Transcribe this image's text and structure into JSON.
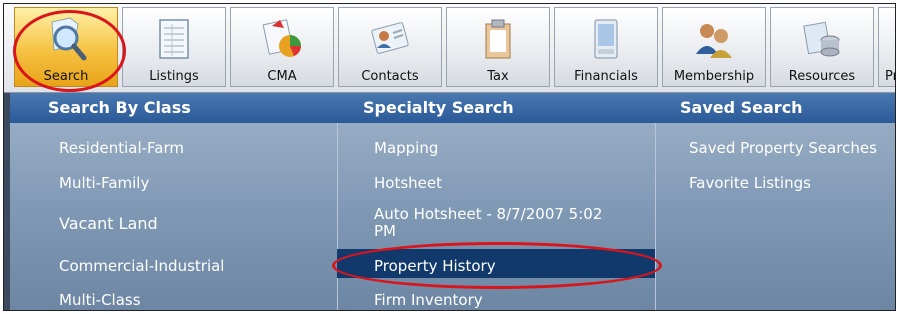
{
  "toolbar": {
    "buttons": [
      {
        "label": "Search",
        "icon": "search-icon"
      },
      {
        "label": "Listings",
        "icon": "listings-icon"
      },
      {
        "label": "CMA",
        "icon": "cma-icon"
      },
      {
        "label": "Contacts",
        "icon": "contacts-icon"
      },
      {
        "label": "Tax",
        "icon": "tax-icon"
      },
      {
        "label": "Financials",
        "icon": "financials-icon"
      },
      {
        "label": "Membership",
        "icon": "membership-icon"
      },
      {
        "label": "Resources",
        "icon": "resources-icon"
      },
      {
        "label": "Pr",
        "icon": "partial-icon"
      }
    ],
    "active": "Search"
  },
  "menu": {
    "columns": [
      {
        "header": "Search By Class",
        "items": [
          "Residential-Farm",
          "Multi-Family",
          "Vacant Land",
          "Commercial-Industrial",
          "Multi-Class"
        ]
      },
      {
        "header": "Specialty Search",
        "items": [
          "Mapping",
          "Hotsheet",
          "Auto Hotsheet - 8/7/2007 5:02 PM",
          "Property History",
          "Firm Inventory"
        ]
      },
      {
        "header": "Saved Search",
        "items": [
          "Saved Property Searches",
          "Favorite Listings"
        ]
      }
    ],
    "highlighted_item": "Property History"
  },
  "colors": {
    "highlight": "#11396c",
    "annotation_circle": "#d9141b",
    "header_bar": "#2a5a98"
  }
}
